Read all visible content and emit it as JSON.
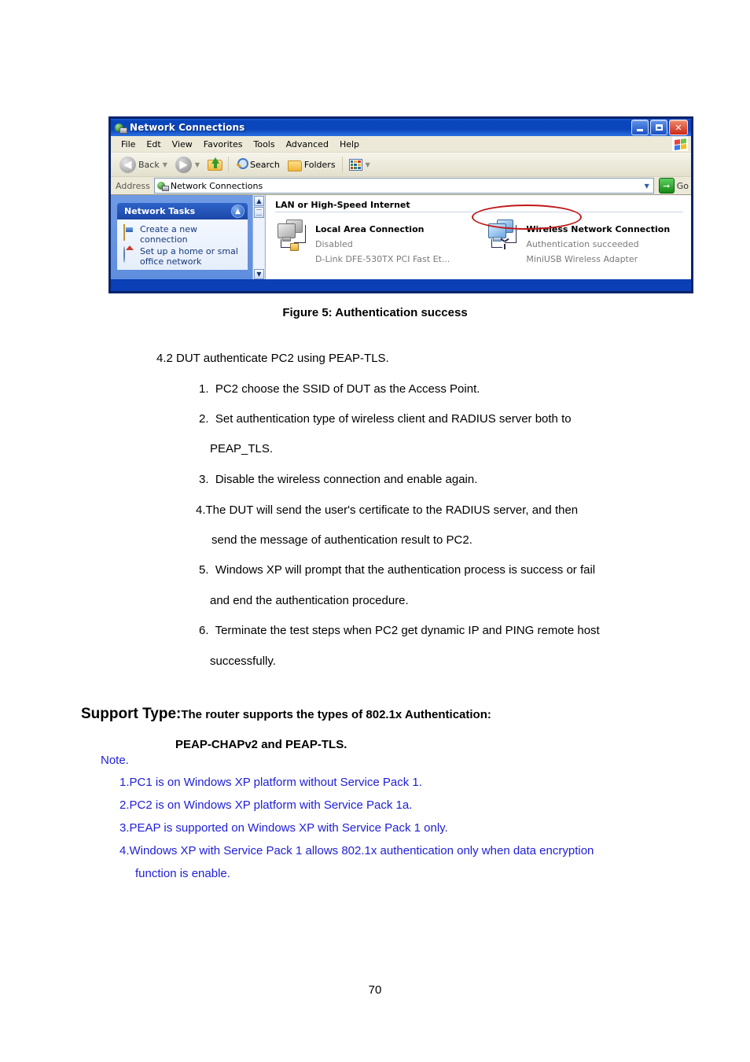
{
  "window": {
    "title": "Network Connections",
    "title_icon": "network-connections-icon",
    "buttons": {
      "minimize": "minimize-button",
      "maximize": "maximize-button",
      "close": "close-button"
    },
    "menu": [
      "File",
      "Edt",
      "View",
      "Favorites",
      "Tools",
      "Advanced",
      "Help"
    ],
    "toolbar": {
      "back_label": "Back",
      "forward_label": "",
      "up_label": "",
      "search_label": "Search",
      "folders_label": "Folders",
      "views_label": ""
    },
    "address": {
      "label": "Address",
      "value": "Network Connections",
      "go_label": "Go"
    },
    "sidebar": {
      "panel_title": "Network Tasks",
      "items": [
        {
          "label": "Create a new connection",
          "icon": "new-connection-icon"
        },
        {
          "label": "Set up a home or smal office network",
          "icon": "home-network-icon"
        }
      ]
    },
    "content": {
      "group_title": "LAN or High-Speed Internet",
      "connections": [
        {
          "name": "Local Area Connection",
          "status": "Disabled",
          "device": "D-Link DFE-530TX PCI Fast Et...",
          "icon": "lan-connection-icon-disabled"
        },
        {
          "name": "Wireless Network Connection",
          "status": "Authentication succeeded",
          "device": "MiniUSB Wireless Adapter",
          "icon": "wireless-connection-icon"
        }
      ],
      "annotation": "red-ellipse-highlight"
    }
  },
  "document": {
    "figure_caption": "Figure 5: Authentication success",
    "section_heading": "4.2 DUT authenticate PC2 using PEAP-TLS.",
    "steps": [
      "1.  PC2 choose the SSID of DUT as the Access Point.",
      "2.  Set authentication type of wireless client and RADIUS server both to",
      "PEAP_TLS.",
      "3.  Disable the wireless connection and enable again.",
      "4.The DUT will send the user's certificate to the RADIUS server, and then",
      "send the message of authentication result to PC2.",
      "5.  Windows XP will prompt that the authentication process is success or fail",
      "and end the authentication procedure.",
      "6.  Terminate the test steps when PC2 get dynamic IP and PING remote host",
      "successfully."
    ],
    "support": {
      "label": "Support Type:",
      "text": "The router supports the types of   802.1x Authentication:",
      "line2": "PEAP-CHAPv2 and PEAP-TLS."
    },
    "note_title": "Note.",
    "notes": [
      "1.PC1 is on Windows XP platform without Service Pack 1.",
      "2.PC2 is on Windows XP platform with Service Pack 1a.",
      "3.PEAP is supported on Windows XP with Service Pack 1 only.",
      "4.Windows XP with Service Pack 1 allows 802.1x authentication only when data encryption",
      "function is enable."
    ],
    "page_number": "70"
  }
}
